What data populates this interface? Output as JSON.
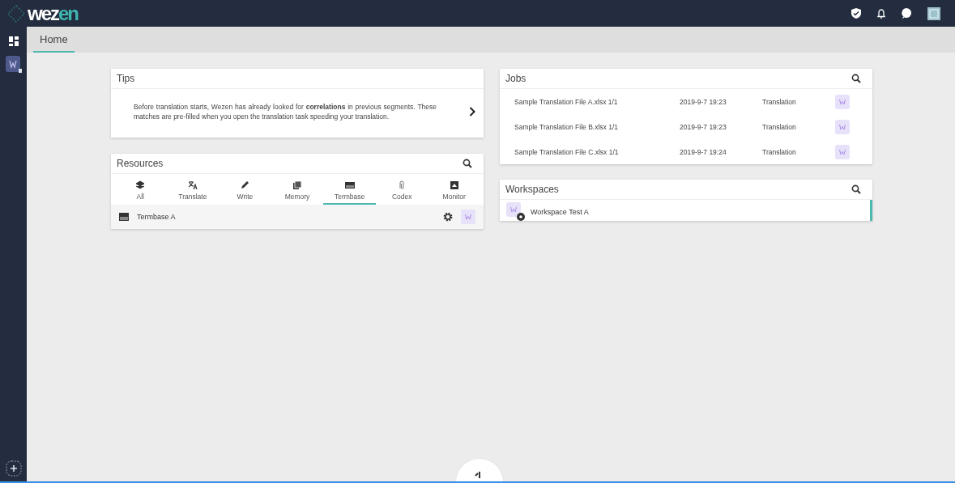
{
  "logo": {
    "main": "wez",
    "accent": "en"
  },
  "tabs": [
    {
      "label": "Home",
      "selected": true
    }
  ],
  "tips": {
    "title": "Tips",
    "text": "Before translation starts, Wezen has already looked for **correlations** in previous segments. These matches are pre-filled when you open the translation task speeding your translation."
  },
  "resources": {
    "title": "Resources",
    "categories": [
      {
        "label": "All",
        "selected": false
      },
      {
        "label": "Translate",
        "selected": false
      },
      {
        "label": "Write",
        "selected": false
      },
      {
        "label": "Memory",
        "selected": false
      },
      {
        "label": "Termbase",
        "selected": true
      },
      {
        "label": "Codex",
        "selected": false
      },
      {
        "label": "Monitor",
        "selected": false
      }
    ],
    "items": [
      {
        "name": "Termbase A"
      }
    ]
  },
  "jobs": {
    "title": "Jobs",
    "rows": [
      {
        "file": "Sample Translation File A.xlsx 1/1",
        "date": "2019-9-7 19:23",
        "type": "Translation"
      },
      {
        "file": "Sample Translation File B.xlsx 1/1",
        "date": "2019-9-7 19:23",
        "type": "Translation"
      },
      {
        "file": "Sample Translation File C.xlsx 1/1",
        "date": "2019-9-7 19:24",
        "type": "Translation"
      }
    ]
  },
  "workspaces": {
    "title": "Workspaces",
    "items": [
      {
        "name": "Workspace Test A",
        "selected": true
      }
    ]
  }
}
